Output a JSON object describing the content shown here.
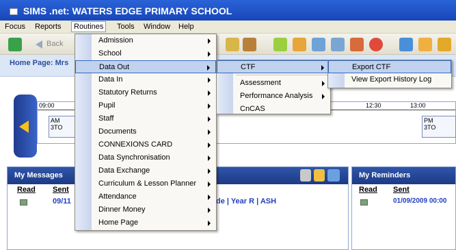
{
  "window": {
    "title": "SIMS .net: WATERS EDGE PRIMARY SCHOOL"
  },
  "menubar": [
    "Focus",
    "Reports",
    "Routines",
    "Tools",
    "Window",
    "Help"
  ],
  "toolbar": {
    "back_label": "Back"
  },
  "home": {
    "label": "Home Page: Mrs"
  },
  "timeline": {
    "ticks": [
      "09:00",
      "12:30",
      "13:00"
    ],
    "slot_am": {
      "session": "AM",
      "group": "3TO"
    },
    "slot_pm": {
      "session": "PM",
      "group": "3TO"
    }
  },
  "messages": {
    "title": "My Messages",
    "col_read": "Read",
    "col_sent": "Sent",
    "row_sent": "09/11",
    "row_text": "de | Year R | ASH"
  },
  "reminders": {
    "title": "My Reminders",
    "col_read": "Read",
    "col_sent": "Sent",
    "row_sent": "01/09/2009 00:00"
  },
  "routines_menu": [
    "Admission",
    "School",
    "Data Out",
    "Data In",
    "Statutory Returns",
    "Pupil",
    "Staff",
    "Documents",
    "CONNEXIONS CARD",
    "Data Synchronisation",
    "Data Exchange",
    "Curriculum & Lesson Planner",
    "Attendance",
    "Dinner Money",
    "Home Page"
  ],
  "dataout_menu": [
    "CTF",
    "Assessment",
    "Performance Analysis",
    "CnCAS"
  ],
  "ctf_menu": [
    "Export CTF",
    "View Export History Log"
  ]
}
